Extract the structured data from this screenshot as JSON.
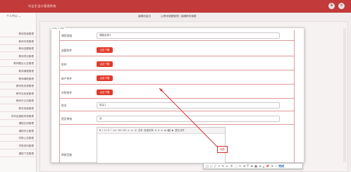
{
  "app": {
    "title": "毕业生设计管理系统"
  },
  "header": {
    "icon_a": "⊕",
    "icon_b": "✕"
  },
  "sidebar": {
    "user_menu": "个人中心 ⌄",
    "items": [
      "教师档案管理",
      "教师列表管理",
      "教师选题管理",
      "教师项目管理",
      "教师题目认定管理",
      "教师课程管理",
      "教师辅助管理",
      "教师类资源管理",
      "教学实验室管理",
      "教师外交流管理",
      "教务档案管理",
      "学科及课程考核管理",
      "课程应用管理",
      "课程作业管理",
      "学院公告管理",
      "学院资料管理",
      "课程下发管理"
    ]
  },
  "tabs": {
    "a": "编辑班级页",
    "b": "(j(教师课题管理 / 编辑教师课题"
  },
  "dialog": {
    "size_label": "1246 × 586"
  },
  "form": {
    "title_label": "课程班级",
    "title_value": "课程名称1",
    "fields": [
      {
        "label": "选题附件",
        "button": "点击下载"
      },
      {
        "label": "附件",
        "button": "点击下载"
      },
      {
        "label": "新产附件",
        "button": "点击下载"
      },
      {
        "label": "学院附件",
        "button": "点击下载"
      }
    ],
    "remark_label": "姓名",
    "remark_value": "姓名1",
    "status_label": "是否审核",
    "status_value": "否",
    "editor_label": "审核回复"
  },
  "editor": {
    "toolbar": [
      "B",
      "I",
      "U",
      "S",
      "\"",
      "<>",
      "H1",
      "H2",
      "≡",
      "≡",
      "小",
      "文本",
      "标准字体",
      "A",
      "A",
      "≡",
      "⊞",
      "🖼",
      "▶",
      "居左对齐"
    ]
  },
  "cursor_box": {
    "label": "回答"
  },
  "shot_bar": {
    "tools": [
      "□",
      "○",
      "╱",
      "↗",
      "✎",
      "▭",
      "Ⓐ",
      "⬚",
      "✂",
      "↺",
      "T",
      "⊕",
      "▦",
      "⊘",
      "⤓",
      "📌",
      "✕"
    ],
    "done": "✓ 完成"
  },
  "colors": {
    "brand": "#c23a3a",
    "button": "#e23a2a",
    "annotation": "#d03030"
  }
}
